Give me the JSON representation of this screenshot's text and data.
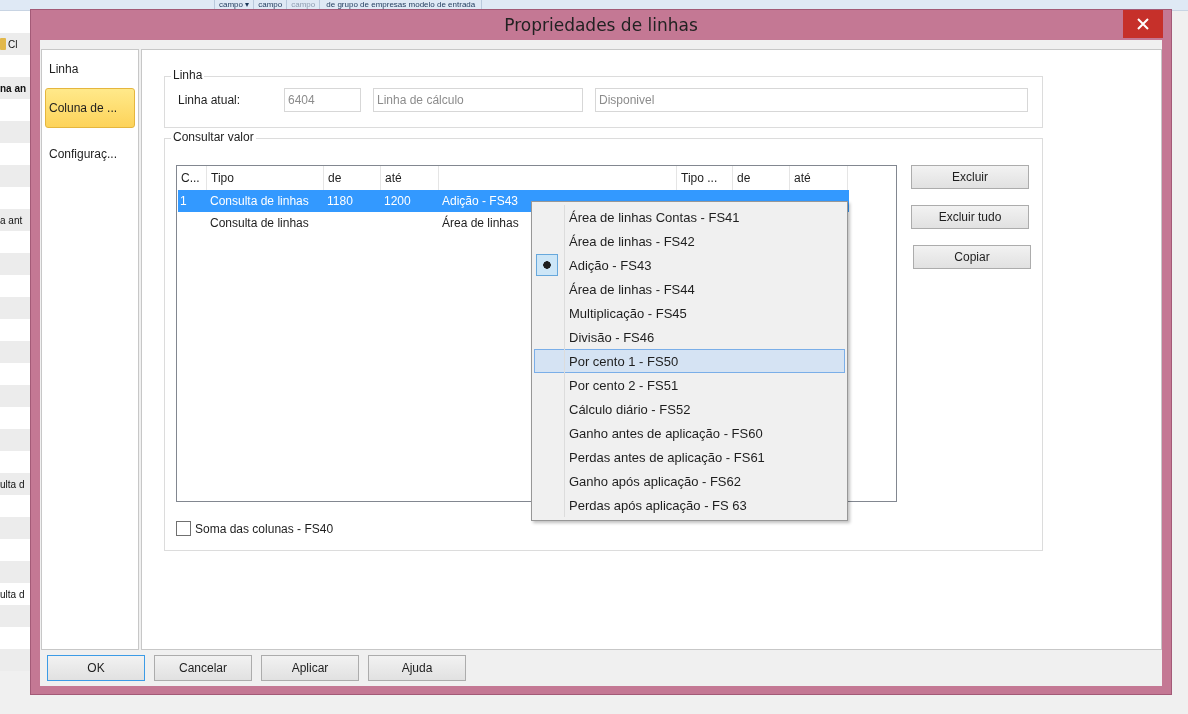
{
  "background_app": {
    "ribbon_labels": [
      {
        "text": "campo ▾",
        "disabled": false
      },
      {
        "text": "campo",
        "disabled": false
      },
      {
        "text": "campo",
        "disabled": true
      },
      {
        "text": "de grupo de empresas  modelo de entrada",
        "disabled": false
      }
    ],
    "left_texts": [
      {
        "text": "Cl",
        "kind": "toolbar"
      },
      {
        "text": "na an",
        "kind": "header"
      },
      {
        "text": "a ant",
        "kind": "cell"
      },
      {
        "text": "ulta d",
        "kind": "cell"
      },
      {
        "text": "ulta d",
        "kind": "cell"
      }
    ]
  },
  "dialog": {
    "title": "Propriedades de linhas",
    "nav": [
      {
        "label": "Linha",
        "selected": false
      },
      {
        "label": "Coluna de ...",
        "selected": true
      },
      {
        "label": "Configuraç...",
        "selected": false
      }
    ],
    "linha_group": {
      "title": "Linha",
      "label": "Linha atual:",
      "fields": [
        {
          "value": "6404"
        },
        {
          "value": "Linha de cálculo"
        },
        {
          "value": "Disponivel"
        }
      ]
    },
    "consultar_group": {
      "title": "Consultar valor",
      "table": {
        "columns": [
          "C...",
          "Tipo",
          "de",
          "até",
          "",
          "Tipo ...",
          "de",
          "até"
        ],
        "rows": [
          {
            "selected": true,
            "cells": [
              "1",
              "Consulta de linhas",
              "1180",
              "1200",
              "Adição - FS43"
            ]
          },
          {
            "selected": false,
            "cells": [
              "",
              "Consulta de linhas",
              "",
              "",
              "Área de linhas"
            ]
          }
        ]
      },
      "buttons": [
        "Excluir",
        "Excluir tudo",
        "Copiar"
      ],
      "checkbox": {
        "label": "Soma das colunas - FS40",
        "checked": false
      }
    },
    "context_menu": [
      {
        "label": "Área de linhas Contas - FS41",
        "checked": false,
        "highlighted": false
      },
      {
        "label": "Área de linhas - FS42",
        "checked": false,
        "highlighted": false
      },
      {
        "label": "Adição - FS43",
        "checked": true,
        "highlighted": false
      },
      {
        "label": "Área de linhas - FS44",
        "checked": false,
        "highlighted": false
      },
      {
        "label": "Multiplicação - FS45",
        "checked": false,
        "highlighted": false
      },
      {
        "label": "Divisão - FS46",
        "checked": false,
        "highlighted": false
      },
      {
        "label": "Por cento 1 - FS50",
        "checked": false,
        "highlighted": true
      },
      {
        "label": "Por cento 2 - FS51",
        "checked": false,
        "highlighted": false
      },
      {
        "label": "Cálculo diário - FS52",
        "checked": false,
        "highlighted": false
      },
      {
        "label": "Ganho antes de aplicação - FS60",
        "checked": false,
        "highlighted": false
      },
      {
        "label": "Perdas antes de aplicação - FS61",
        "checked": false,
        "highlighted": false
      },
      {
        "label": "Ganho após aplicação - FS62",
        "checked": false,
        "highlighted": false
      },
      {
        "label": "Perdas após aplicação - FS 63",
        "checked": false,
        "highlighted": false
      }
    ],
    "footer_buttons": [
      {
        "label": "OK",
        "default": true
      },
      {
        "label": "Cancelar",
        "default": false
      },
      {
        "label": "Aplicar",
        "default": false
      },
      {
        "label": "Ajuda",
        "default": false
      }
    ]
  }
}
